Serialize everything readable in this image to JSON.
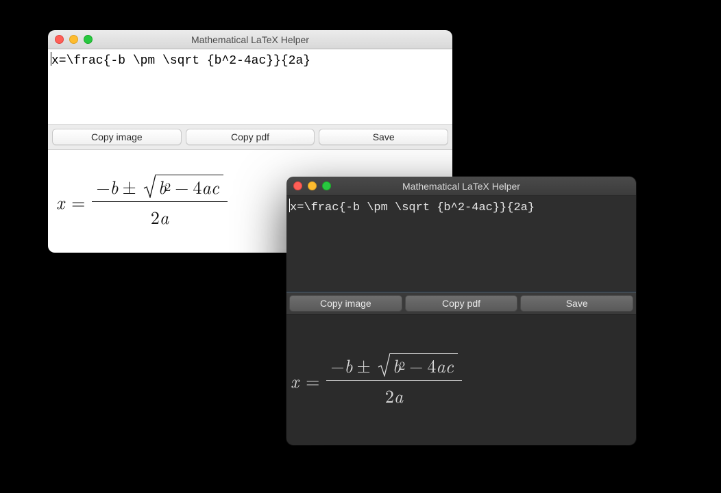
{
  "light": {
    "title": "Mathematical LaTeX Helper",
    "latex_input": "x=\\frac{-b \\pm \\sqrt {b^2-4ac}}{2a}",
    "buttons": {
      "copy_image": "Copy image",
      "copy_pdf": "Copy pdf",
      "save": "Save"
    },
    "formula": {
      "lhs_var": "x",
      "eq": "=",
      "neg": "−",
      "b": "b",
      "pm": "±",
      "rad_b": "b",
      "sq": "2",
      "minus": "−",
      "four": "4",
      "a": "a",
      "c": "c",
      "den_two": "2",
      "den_a": "a"
    }
  },
  "dark": {
    "title": "Mathematical LaTeX Helper",
    "latex_input": "x=\\frac{-b \\pm \\sqrt {b^2-4ac}}{2a}",
    "buttons": {
      "copy_image": "Copy image",
      "copy_pdf": "Copy pdf",
      "save": "Save"
    },
    "formula": {
      "lhs_var": "x",
      "eq": "=",
      "neg": "−",
      "b": "b",
      "pm": "±",
      "rad_b": "b",
      "sq": "2",
      "minus": "−",
      "four": "4",
      "a": "a",
      "c": "c",
      "den_two": "2",
      "den_a": "a"
    }
  }
}
